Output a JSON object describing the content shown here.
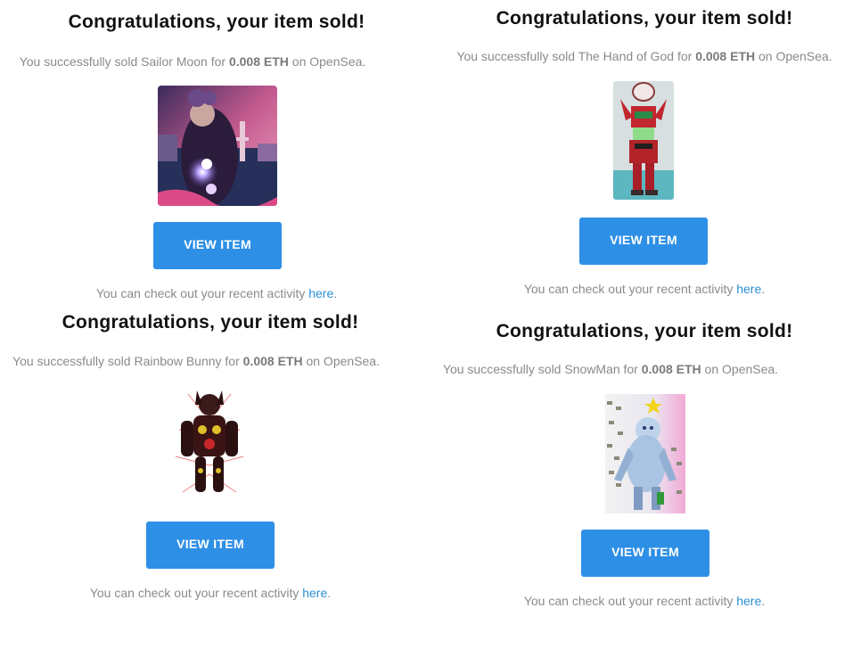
{
  "cards": [
    {
      "title": "Congratulations, your item sold!",
      "sold_prefix": "You successfully sold Sailor Moon for ",
      "price": "0.008 ETH",
      "sold_suffix": " on OpenSea.",
      "button_label": "VIEW ITEM",
      "activity_prefix": "You can check out your recent activity ",
      "activity_link": "here",
      "activity_suffix": "."
    },
    {
      "title": "Congratulations, your item sold!",
      "sold_prefix": "You successfully sold The Hand of God for ",
      "price": "0.008 ETH",
      "sold_suffix": " on OpenSea.",
      "button_label": "VIEW ITEM",
      "activity_prefix": "You can check out your recent activity ",
      "activity_link": "here",
      "activity_suffix": "."
    },
    {
      "title": "Congratulations, your item sold!",
      "sold_prefix": "You successfully sold Rainbow Bunny for ",
      "price": "0.008 ETH",
      "sold_suffix": " on OpenSea.",
      "button_label": "VIEW ITEM",
      "activity_prefix": "You can check out your recent activity ",
      "activity_link": "here",
      "activity_suffix": "."
    },
    {
      "title": "Congratulations, your item sold!",
      "sold_prefix": "You successfully sold SnowMan for ",
      "price": "0.008 ETH",
      "sold_suffix": " on OpenSea.",
      "button_label": "VIEW ITEM",
      "activity_prefix": "You can check out your recent activity ",
      "activity_link": "here",
      "activity_suffix": "."
    }
  ],
  "colors": {
    "button": "#2e8fe6",
    "link": "#2a8fd6",
    "body_text": "#8a8a8a",
    "headline": "#111111"
  }
}
